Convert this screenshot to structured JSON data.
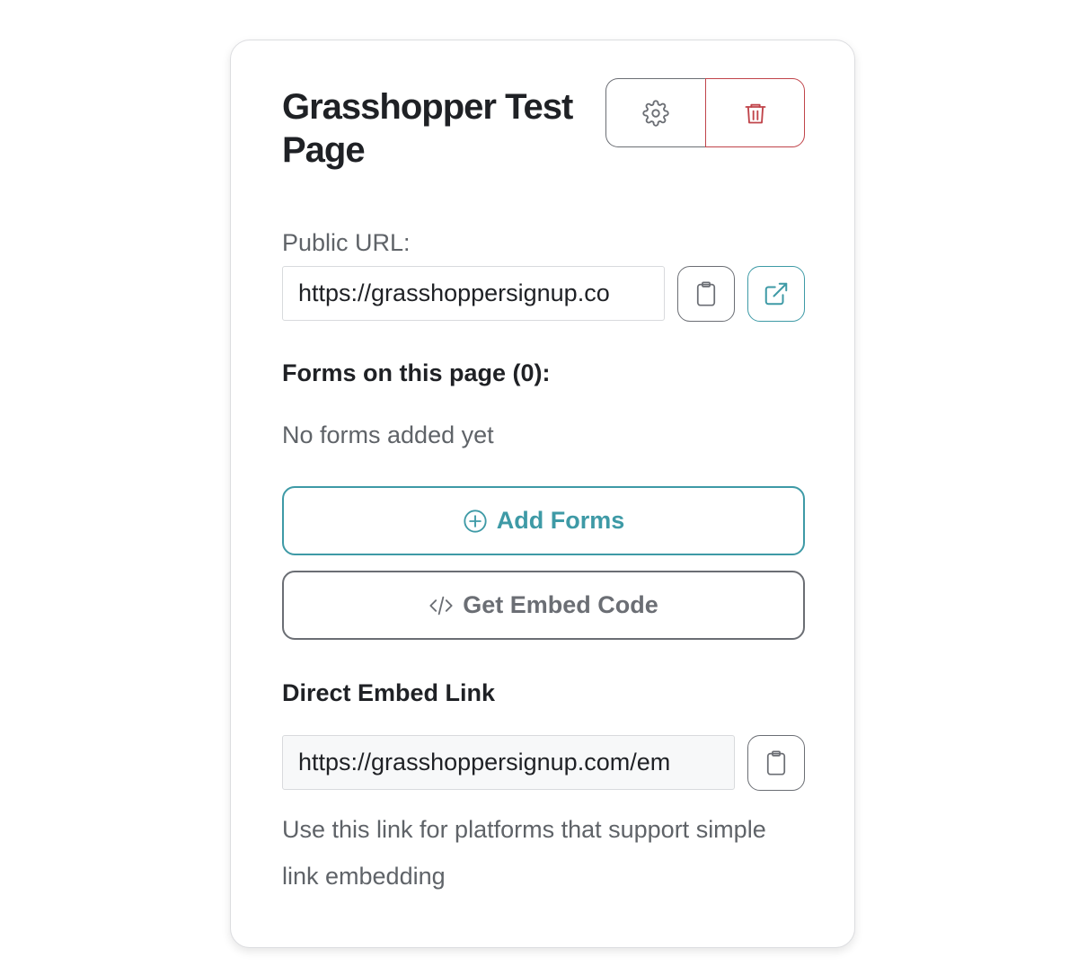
{
  "card": {
    "title": "Grasshopper Test Page",
    "actions": {
      "settings_icon": "gear-icon",
      "delete_icon": "trash-icon"
    },
    "public_url": {
      "label": "Public URL:",
      "value": "https://grasshoppersignup.co",
      "copy_icon": "clipboard-icon",
      "open_icon": "external-link-icon"
    },
    "forms": {
      "heading": "Forms on this page (0):",
      "empty_text": "No forms added yet",
      "add_button": "Add Forms",
      "add_icon": "plus-circle-icon",
      "embed_button": "Get Embed Code",
      "embed_icon": "code-icon"
    },
    "direct_embed": {
      "heading": "Direct Embed Link",
      "value": "https://grasshoppersignup.com/em",
      "copy_icon": "clipboard-icon",
      "help_text": "Use this link for platforms that support simple link embedding"
    }
  },
  "colors": {
    "accent": "#3e9aa6",
    "danger": "#c0444a",
    "muted": "#5f6368",
    "border": "#6b6e74"
  }
}
